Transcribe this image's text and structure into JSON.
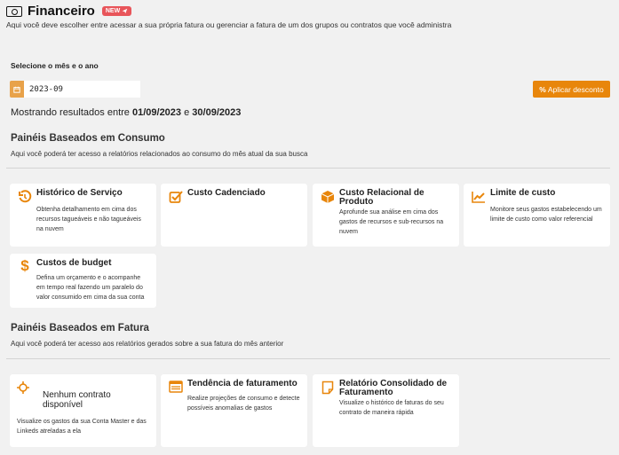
{
  "header": {
    "title": "Financeiro",
    "badge": "NEW",
    "subtitle": "Aqui você deve escolher entre acessar a sua própria fatura ou gerenciar a fatura de um dos grupos ou contratos que você administra"
  },
  "filter": {
    "month_label": "Selecione o mês e o ano",
    "month_value": "2023-09",
    "discount_button": "Aplicar desconto",
    "range_prefix": "Mostrando resultados entre",
    "range_start": "01/09/2023",
    "range_joiner": "e",
    "range_end": "30/09/2023"
  },
  "consumo": {
    "title": "Painéis Baseados em Consumo",
    "subtitle": "Aqui você poderá ter acesso a relatórios relacionados ao consumo do mês atual da sua busca",
    "cards": [
      {
        "title": "Histórico de Serviço",
        "desc": "Obtenha detalhamento em cima dos recursos tagueáveis e não tagueáveis na nuvem",
        "icon": "history-icon"
      },
      {
        "title": "Custo Cadenciado",
        "desc": "",
        "icon": "checkbox-icon"
      },
      {
        "title": "Custo Relacional de Produto",
        "desc": "Aprofunde sua análise em cima dos gastos de recursos e sub-recursos na nuvem",
        "icon": "cube-icon"
      },
      {
        "title": "Limite de custo",
        "desc": "Monitore seus gastos estabelecendo um limite de custo como valor referencial",
        "icon": "line-chart-icon"
      },
      {
        "title": "Custos de budget",
        "desc": "Defina um orçamento e o acompanhe em tempo real fazendo um paralelo do valor consumido em cima da sua conta",
        "icon": "dollar-icon"
      }
    ]
  },
  "fatura": {
    "title": "Painéis Baseados em Fatura",
    "subtitle": "Aqui você poderá ter acesso aos relatórios gerados sobre a sua fatura do mês anterior",
    "cards": [
      {
        "title": "Nenhum contrato disponível",
        "desc": "Visualize os gastos da sua Conta Master e das Linkeds atreladas a ela",
        "icon": "crosshair-icon"
      },
      {
        "title": "Tendência de faturamento",
        "desc": "Realize projeções de consumo e detecte possíveis anomalias de gastos",
        "icon": "list-window-icon"
      },
      {
        "title": "Relatório Consolidado de Faturamento",
        "desc": "Visualize o histórico de faturas do seu contrato de maneira rápida",
        "icon": "sticky-note-icon"
      }
    ]
  },
  "colors": {
    "accent": "#e8860b",
    "badge": "#e8555a",
    "background": "#f1f1f1"
  }
}
